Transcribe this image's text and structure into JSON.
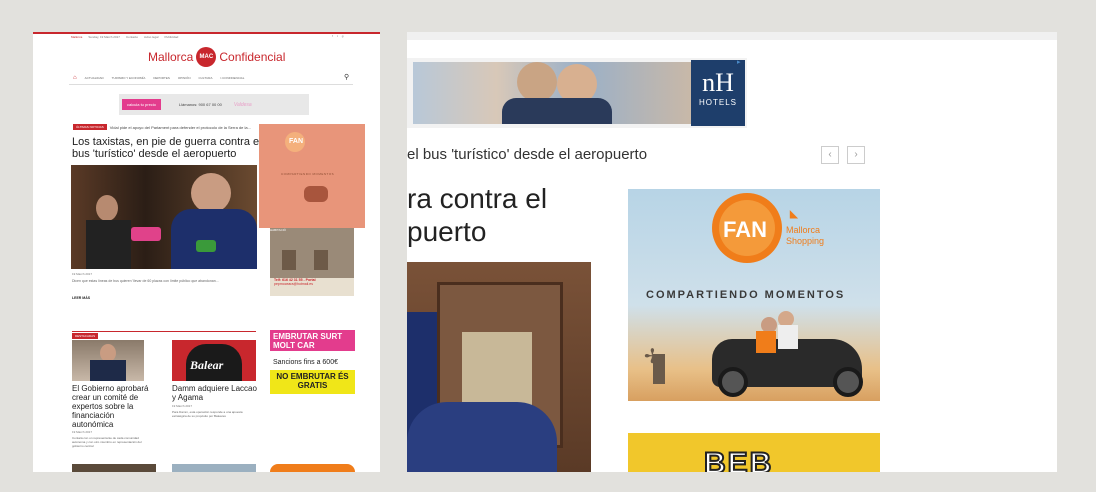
{
  "left_site": {
    "top_bar": {
      "items": [
        "Mallorca",
        "Sunday, 19 March 2017",
        "Contacto",
        "Aviso legal",
        "Publicidad"
      ],
      "social": [
        "f",
        "t",
        "g"
      ]
    },
    "logo": {
      "left": "Mallorca",
      "badge": "MAC",
      "right": "Confidencial"
    },
    "nav": [
      "ACTUALIDAD",
      "TURISMO Y ECONOMÍA",
      "DEPORTES",
      "OPINIÓN",
      "CULTURA",
      "I.CONFIDENCIAL"
    ],
    "banner": {
      "left_text": "calcula tu precio",
      "phone": "Llámanos: 900 67 00 00",
      "brand": "Valdesa"
    },
    "breaking": {
      "badge": "ÚLTIMAS NOTICIAS",
      "text": "Vidal pide el apoyo del Parlament para defender el protocolo de la Serra de la..."
    },
    "main_article": {
      "headline": "Los taxistas, en pie de guerra contra el bus 'turístico' desde el aeropuerto",
      "date": "19 March 2017",
      "excerpt": "Dicen que estas líneas de bus quieren 'llevar de 60 plazas con límite público que abandonan...",
      "readmore": "LEER MÁS"
    },
    "sidebar_ad1": {
      "brand": "FAN",
      "tagline": "COMPARTIENDO MOMENTOS"
    },
    "sidebar_ad2": {
      "title": "HABITACIÓ",
      "phone": "Telf: 616 42 31 55 - Portal",
      "email": "pepmoceara@hotmail.es"
    },
    "section_badge": "DESTACADAS",
    "card1": {
      "headline": "El Gobierno aprobará crear un comité de expertos sobre la financiación autonómica",
      "date": "19 March 2017",
      "excerpt": "Contará con un representante de cada comunidad autónoma y con otro miembro en representación del gobierno central"
    },
    "card2": {
      "brand": "Balear",
      "headline": "Damm adquiere Laccao y Agama",
      "date": "19 March 2017",
      "excerpt": "Para Damm, esta operación responde a una apuesta estratégica de su propósito por Baleares"
    },
    "embrutar_ad": {
      "top": "EMBRUTAR SURT MOLT CAR",
      "mid": "Sancions fins a 600€",
      "bottom": "NO EMBRUTAR ÉS GRATIS"
    }
  },
  "right_zoom": {
    "ad": {
      "brand": "nH",
      "sub": "HOTELS"
    },
    "ticker_text": "el bus 'turístico' desde el aeropuerto",
    "prev_icon": "chevron-left-icon",
    "next_icon": "chevron-right-icon",
    "headline_line1": "ra contra el",
    "headline_line2": "puerto",
    "fan_ad": {
      "brand": "FAN",
      "sub1": "Mallorca",
      "sub2": "Shopping",
      "tagline": "COMPARTIENDO MOMENTOS"
    },
    "bottom_ad_text": "BEB"
  },
  "colors": {
    "accent": "#c8272d",
    "fan_orange": "#f07d1a",
    "sky": "#a9cbe0",
    "nh_navy": "#1e3e6b"
  }
}
